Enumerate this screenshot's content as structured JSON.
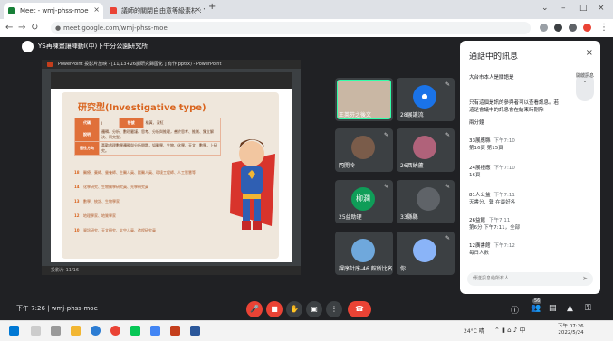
{
  "browser": {
    "tabs": [
      {
        "label": "Meet - wmj-phss-moe",
        "color": "#188038"
      },
      {
        "label": "議師的關閉自由意等級素材 : Y",
        "color": "#ea4335"
      }
    ],
    "new_tab": "+",
    "url": "meet.google.com/wmj-phss-moe"
  },
  "meet": {
    "meeting_name": "YS再陳畫讓陣動I(中)下午分公園研究所",
    "presentation": {
      "window_title": "PowerPoint 投影片放映 - [11/13+26課研究歸國化 ] 有作 ppt(x) - PowerPoint",
      "status": "投影片 11/16",
      "slide": {
        "title": "研究型(Investigative type)",
        "table": [
          {
            "head": "代碼",
            "cells": [
              "I",
              "符號",
              "橘黃、深紅"
            ]
          },
          {
            "head": "說明",
            "cells": [
              "邏輯、分析、數理嚴謹、思考、分析與推理，善於思考、推測、獨立解決、研究型。"
            ]
          },
          {
            "head": "適性方向",
            "cells": [
              "喜歡處理數學邏輯與分析問題，如醫學、生物、化學、天文、數學，上研究。"
            ]
          }
        ],
        "bullets": [
          {
            "num": "18",
            "text": "醫療、藥師、營養師、生醫人員、獸醫人員、環境工程師、人工智慧等"
          },
          {
            "num": "14",
            "text": "化學研究、生物醫學研究員、光學研究員"
          },
          {
            "num": "13",
            "text": "數學、統計、生物學家"
          },
          {
            "num": "12",
            "text": "地理學家、地質學家"
          },
          {
            "num": "10",
            "text": "資訊研究、天文研究、太空人員、造程研究員"
          }
        ]
      }
    },
    "participants": [
      {
        "name": "王英芬之後文",
        "avatar_color": "#c9b7a4"
      },
      {
        "name": "28展讓流",
        "avatar_color": "#1a73e8"
      },
      {
        "name": "門開冷",
        "avatar_color": "#7a5c4a"
      },
      {
        "name": "26西納蘆",
        "avatar_color": "#b0627a"
      },
      {
        "name": "25益助理",
        "avatar_color": "#0f9d58"
      },
      {
        "name": "33縣縣",
        "avatar_color": "#5f6368"
      },
      {
        "name": "課序計序-46 館所比名",
        "avatar_color": "#6fa8dc"
      },
      {
        "name": "你",
        "avatar_color": "#8ab4f8"
      }
    ],
    "participant_initial": "柳澗",
    "chat": {
      "title": "通話中的訊息",
      "messages": [
        {
          "sender": "大台市本人是關語是",
          "time": "",
          "text": ""
        },
        {
          "sender": "只有這個是訊的參與者可以查看訊息。若這是會議中的訊息會在結束時刪除",
          "time": "",
          "text": ""
        },
        {
          "sender": "兩分鐘",
          "time": "",
          "text": ""
        },
        {
          "sender": "33展應縣",
          "time": "下午7:10",
          "text": "第16頁 第15頁"
        },
        {
          "sender": "24展禮應",
          "time": "下午7:10",
          "text": "16頁"
        },
        {
          "sender": "81人公益",
          "time": "下午7:11",
          "text": "天書分、聲 在最好各"
        },
        {
          "sender": "26益館",
          "time": "下午7:11",
          "text": "第6分 下午7:11，全部"
        },
        {
          "sender": "12廣書館",
          "time": "下午7:12",
          "text": "每日人數"
        }
      ],
      "input_placeholder": "傳送訊息給所有人",
      "pin_label": "開啟訊息"
    },
    "meeting_time": "下午 7:26",
    "meeting_code": "wmj-phss-moe",
    "participant_count": "56"
  },
  "taskbar": {
    "weather": "24°C 晴",
    "time": "下午 07:26",
    "date": "2022/5/24"
  },
  "colors": {
    "accent": "#1a73e8",
    "danger": "#ea4335",
    "slide_accent": "#d9641e"
  }
}
